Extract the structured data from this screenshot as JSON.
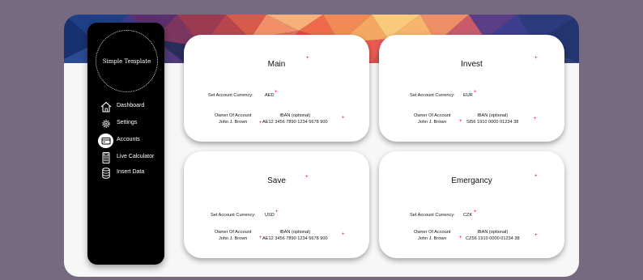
{
  "sidebar": {
    "logo_text": "Simple Template",
    "items": [
      {
        "label": "Dashboard",
        "icon": "home-icon"
      },
      {
        "label": "Settings",
        "icon": "gear-icon"
      },
      {
        "label": "Accounts",
        "icon": "wallet-icon",
        "active": true
      },
      {
        "label": "Live Calculator",
        "icon": "calculator-icon"
      },
      {
        "label": "Insert Data",
        "icon": "database-icon"
      }
    ]
  },
  "accounts": [
    {
      "title": "Main",
      "currency_label": "Set Account Currency:",
      "currency": "AED",
      "owner_label": "Owner Of Account",
      "owner": "John J. Brown",
      "iban_label": "IBAN (optional)",
      "iban": "AE12 3456 7890 1234 5678 900"
    },
    {
      "title": "Invest",
      "currency_label": "Set Account Currency:",
      "currency": "EUR",
      "owner_label": "Owner Of Account",
      "owner": "John J. Brown",
      "iban_label": "IBAN (optional)",
      "iban": "SI56 1910 0000 01234 38"
    },
    {
      "title": "Save",
      "currency_label": "Set Account Currency:",
      "currency": "USD",
      "owner_label": "Owner Of Account",
      "owner": "John J. Brown",
      "iban_label": "IBAN (optional)",
      "iban": "AE12 3456 7890 1234 5678 900"
    },
    {
      "title": "Emergancy",
      "currency_label": "Set Account Currency:",
      "currency": "CZK",
      "owner_label": "Owner Of Account",
      "owner": "John J. Brown",
      "iban_label": "IBAN (optional)",
      "iban": "CZ56 1910 0000 01234 38"
    }
  ],
  "colors": {
    "page_bg": "#756a80",
    "sidebar_bg": "#000000",
    "required_marker": "#e0002e"
  }
}
